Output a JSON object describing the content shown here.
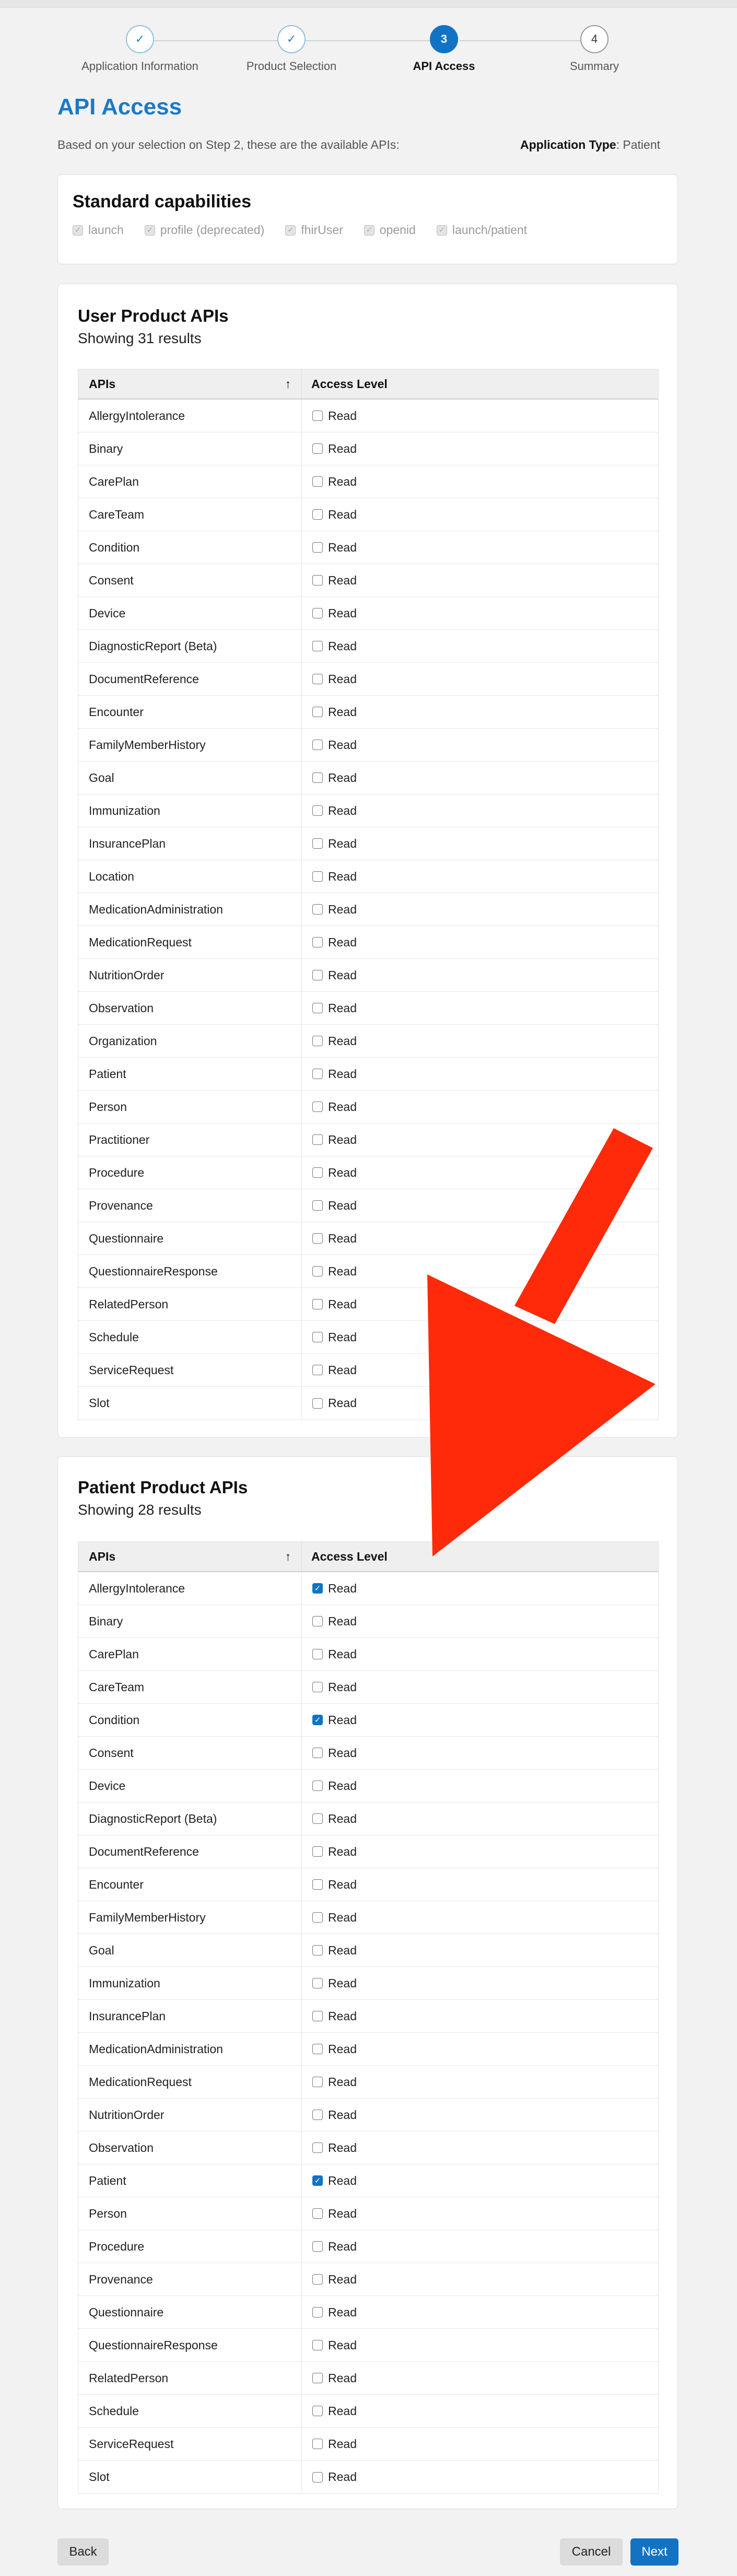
{
  "steps": [
    {
      "label": "Application Information",
      "status": "done",
      "number": ""
    },
    {
      "label": "Product Selection",
      "status": "done",
      "number": ""
    },
    {
      "label": "API Access",
      "status": "active",
      "number": "3"
    },
    {
      "label": "Summary",
      "status": "todo",
      "number": "4"
    }
  ],
  "page": {
    "title": "API Access",
    "subtitle": "Based on your selection on Step 2, these are the available APIs:",
    "app_type_label": "Application Type",
    "app_type_value": ": Patient"
  },
  "standard": {
    "title": "Standard capabilities",
    "items": [
      "launch",
      "profile (deprecated)",
      "fhirUser",
      "openid",
      "launch/patient"
    ]
  },
  "user_apis": {
    "title": "User Product APIs",
    "count": "Showing 31 results",
    "col_api": "APIs",
    "col_access": "Access Level",
    "rows": [
      {
        "api": "AllergyIntolerance",
        "access": "Read",
        "checked": false
      },
      {
        "api": "Binary",
        "access": "Read",
        "checked": false
      },
      {
        "api": "CarePlan",
        "access": "Read",
        "checked": false
      },
      {
        "api": "CareTeam",
        "access": "Read",
        "checked": false
      },
      {
        "api": "Condition",
        "access": "Read",
        "checked": false
      },
      {
        "api": "Consent",
        "access": "Read",
        "checked": false
      },
      {
        "api": "Device",
        "access": "Read",
        "checked": false
      },
      {
        "api": "DiagnosticReport (Beta)",
        "access": "Read",
        "checked": false
      },
      {
        "api": "DocumentReference",
        "access": "Read",
        "checked": false
      },
      {
        "api": "Encounter",
        "access": "Read",
        "checked": false
      },
      {
        "api": "FamilyMemberHistory",
        "access": "Read",
        "checked": false
      },
      {
        "api": "Goal",
        "access": "Read",
        "checked": false
      },
      {
        "api": "Immunization",
        "access": "Read",
        "checked": false
      },
      {
        "api": "InsurancePlan",
        "access": "Read",
        "checked": false
      },
      {
        "api": "Location",
        "access": "Read",
        "checked": false
      },
      {
        "api": "MedicationAdministration",
        "access": "Read",
        "checked": false
      },
      {
        "api": "MedicationRequest",
        "access": "Read",
        "checked": false
      },
      {
        "api": "NutritionOrder",
        "access": "Read",
        "checked": false
      },
      {
        "api": "Observation",
        "access": "Read",
        "checked": false
      },
      {
        "api": "Organization",
        "access": "Read",
        "checked": false
      },
      {
        "api": "Patient",
        "access": "Read",
        "checked": false
      },
      {
        "api": "Person",
        "access": "Read",
        "checked": false
      },
      {
        "api": "Practitioner",
        "access": "Read",
        "checked": false
      },
      {
        "api": "Procedure",
        "access": "Read",
        "checked": false
      },
      {
        "api": "Provenance",
        "access": "Read",
        "checked": false
      },
      {
        "api": "Questionnaire",
        "access": "Read",
        "checked": false
      },
      {
        "api": "QuestionnaireResponse",
        "access": "Read",
        "checked": false
      },
      {
        "api": "RelatedPerson",
        "access": "Read",
        "checked": false
      },
      {
        "api": "Schedule",
        "access": "Read",
        "checked": false
      },
      {
        "api": "ServiceRequest",
        "access": "Read",
        "checked": false
      },
      {
        "api": "Slot",
        "access": "Read",
        "checked": false
      }
    ]
  },
  "patient_apis": {
    "title": "Patient Product APIs",
    "count": "Showing 28 results",
    "col_api": "APIs",
    "col_access": "Access Level",
    "rows": [
      {
        "api": "AllergyIntolerance",
        "access": "Read",
        "checked": true
      },
      {
        "api": "Binary",
        "access": "Read",
        "checked": false
      },
      {
        "api": "CarePlan",
        "access": "Read",
        "checked": false
      },
      {
        "api": "CareTeam",
        "access": "Read",
        "checked": false
      },
      {
        "api": "Condition",
        "access": "Read",
        "checked": true
      },
      {
        "api": "Consent",
        "access": "Read",
        "checked": false
      },
      {
        "api": "Device",
        "access": "Read",
        "checked": false
      },
      {
        "api": "DiagnosticReport (Beta)",
        "access": "Read",
        "checked": false
      },
      {
        "api": "DocumentReference",
        "access": "Read",
        "checked": false
      },
      {
        "api": "Encounter",
        "access": "Read",
        "checked": false
      },
      {
        "api": "FamilyMemberHistory",
        "access": "Read",
        "checked": false
      },
      {
        "api": "Goal",
        "access": "Read",
        "checked": false
      },
      {
        "api": "Immunization",
        "access": "Read",
        "checked": false
      },
      {
        "api": "InsurancePlan",
        "access": "Read",
        "checked": false
      },
      {
        "api": "MedicationAdministration",
        "access": "Read",
        "checked": false
      },
      {
        "api": "MedicationRequest",
        "access": "Read",
        "checked": false
      },
      {
        "api": "NutritionOrder",
        "access": "Read",
        "checked": false
      },
      {
        "api": "Observation",
        "access": "Read",
        "checked": false
      },
      {
        "api": "Patient",
        "access": "Read",
        "checked": true
      },
      {
        "api": "Person",
        "access": "Read",
        "checked": false
      },
      {
        "api": "Procedure",
        "access": "Read",
        "checked": false
      },
      {
        "api": "Provenance",
        "access": "Read",
        "checked": false
      },
      {
        "api": "Questionnaire",
        "access": "Read",
        "checked": false
      },
      {
        "api": "QuestionnaireResponse",
        "access": "Read",
        "checked": false
      },
      {
        "api": "RelatedPerson",
        "access": "Read",
        "checked": false
      },
      {
        "api": "Schedule",
        "access": "Read",
        "checked": false
      },
      {
        "api": "ServiceRequest",
        "access": "Read",
        "checked": false
      },
      {
        "api": "Slot",
        "access": "Read",
        "checked": false
      }
    ]
  },
  "footer": {
    "back": "Back",
    "cancel": "Cancel",
    "next": "Next"
  },
  "colors": {
    "accent": "#1273c4",
    "title": "#1a7ac9",
    "annotation_arrow": "#ff2a0a"
  },
  "icons": {
    "completed_step": "checkmark-icon",
    "sort": "sort-ascending-arrow-icon",
    "checkbox_checked": "checkmark-icon"
  }
}
